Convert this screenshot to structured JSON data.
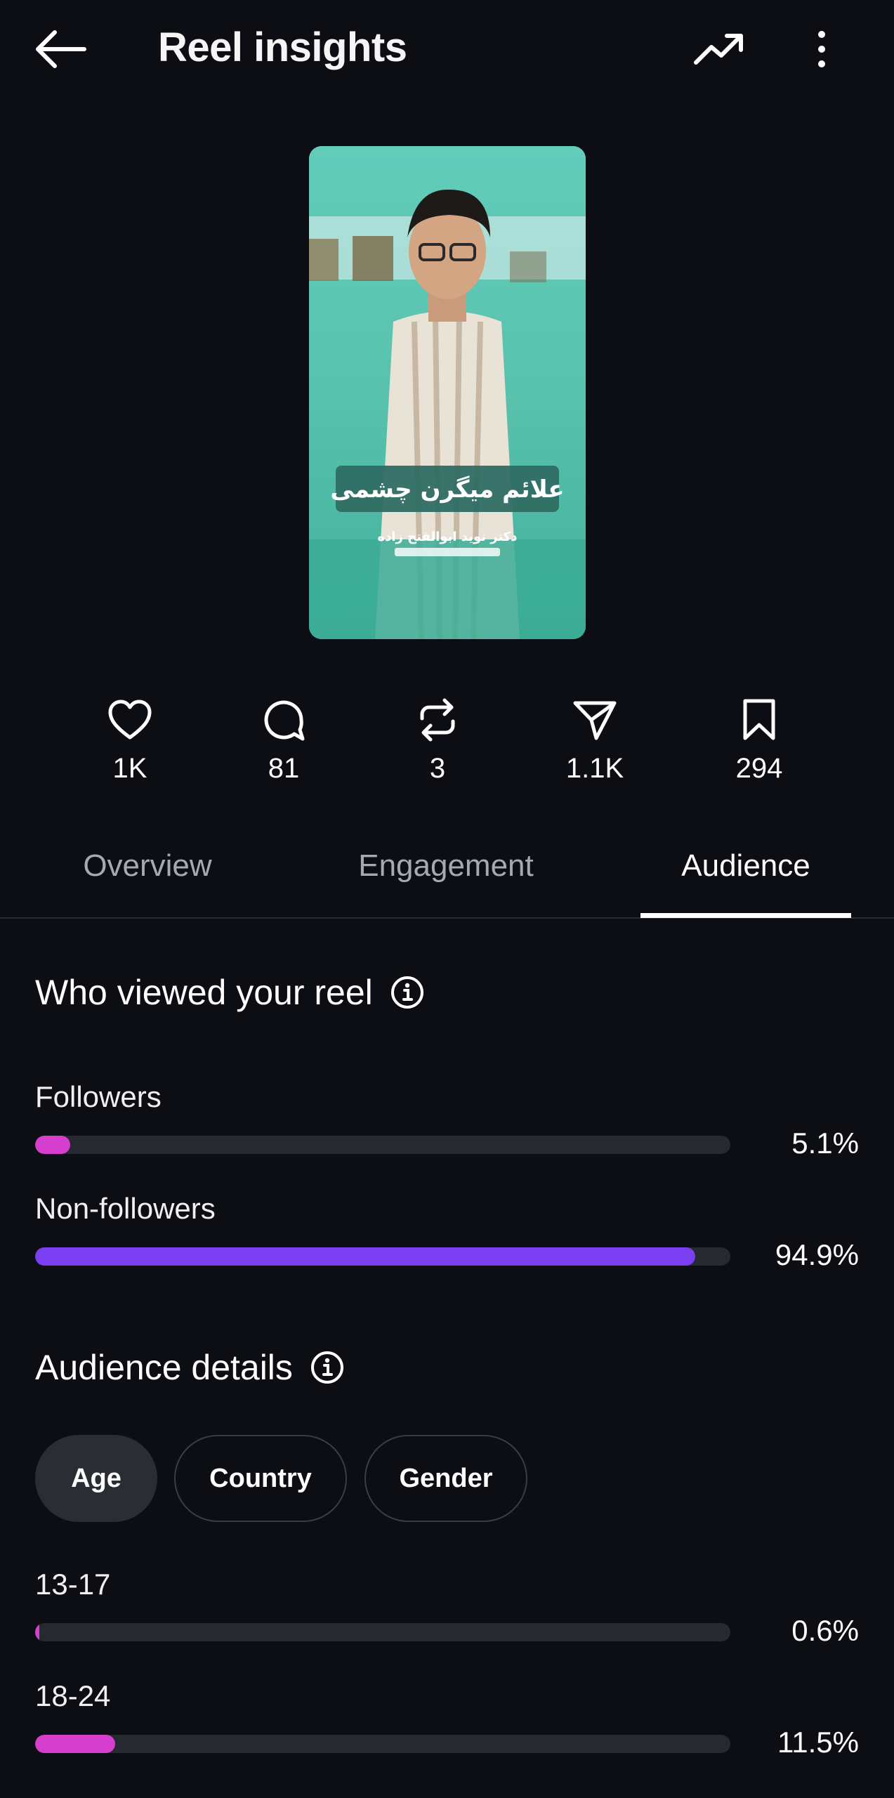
{
  "header": {
    "title": "Reel insights"
  },
  "reel": {
    "caption_main": "علائم میگرن چشمی",
    "caption_sub": "دکتر نوید ابوالفتح زاده"
  },
  "stats": {
    "likes": "1K",
    "comments": "81",
    "reposts": "3",
    "shares": "1.1K",
    "saves": "294"
  },
  "tabs": [
    {
      "label": "Overview"
    },
    {
      "label": "Engagement"
    },
    {
      "label": "Audience",
      "active": true
    }
  ],
  "viewers": {
    "title": "Who viewed your reel",
    "rows": [
      {
        "label": "Followers",
        "percent_text": "5.1%",
        "value": 0.051,
        "color": "#d63ecd"
      },
      {
        "label": "Non-followers",
        "percent_text": "94.9%",
        "value": 0.949,
        "color": "#7b3ff2"
      }
    ]
  },
  "audience_details": {
    "title": "Audience details",
    "chips": [
      {
        "label": "Age",
        "active": true
      },
      {
        "label": "Country",
        "active": false
      },
      {
        "label": "Gender",
        "active": false
      }
    ],
    "rows": [
      {
        "label": "13-17",
        "percent_text": "0.6%",
        "value": 0.006,
        "color": "#d63ecd"
      },
      {
        "label": "18-24",
        "percent_text": "11.5%",
        "value": 0.115,
        "color": "#d63ecd"
      }
    ]
  },
  "colors": {
    "background": "#0c0e13",
    "track": "#26292f",
    "pink": "#d63ecd",
    "purple": "#7b3ff2"
  }
}
